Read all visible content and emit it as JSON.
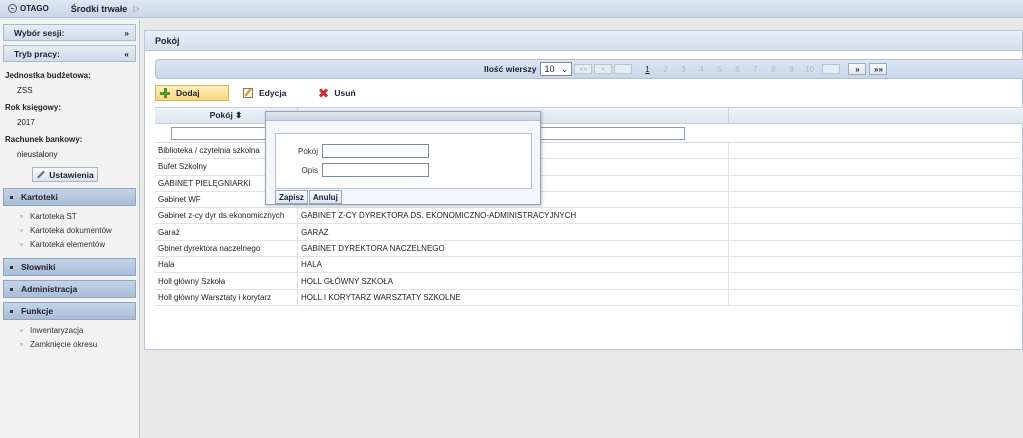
{
  "topbar": {
    "logo": "OTAGO",
    "crumb": "Środki trwałe",
    "arrow": "▷"
  },
  "sidebar": {
    "session_header": {
      "label": "Wybór sesji:",
      "icon": "»"
    },
    "mode_header": {
      "label": "Tryb pracy:",
      "icon": "«"
    },
    "info": [
      {
        "label": "Jednostka budżetowa:",
        "value": "ZSS"
      },
      {
        "label": "Rok księgowy:",
        "value": "2017"
      },
      {
        "label": "Rachunek bankowy:",
        "value": "nieustalony"
      }
    ],
    "settings_button": "Ustawienia",
    "sections": [
      {
        "title": "Kartoteki",
        "items": [
          "Kartoteka ST",
          "Kartoteka dokumentów",
          "Kartoteka elementów"
        ]
      },
      {
        "title": "Słowniki",
        "items": []
      },
      {
        "title": "Administracja",
        "items": []
      },
      {
        "title": "Funkcje",
        "items": [
          "Inwentaryzacja",
          "Zamknięcie okresu"
        ]
      }
    ]
  },
  "panel": {
    "title": "Pokój"
  },
  "pager": {
    "rows_label": "Ilość wierszy",
    "rows_value": "10",
    "first": "««",
    "prev": "«",
    "pages": [
      "1",
      "2",
      "3",
      "4",
      "5",
      "6",
      "7",
      "8",
      "9",
      "10"
    ],
    "current_page": "1",
    "next": "»",
    "last": "»»"
  },
  "toolbar": {
    "add": "Dodaj",
    "edit": "Edycja",
    "delete": "Usuń"
  },
  "grid": {
    "columns": [
      "Pokój ⬍",
      "",
      ""
    ],
    "rows": [
      {
        "room": "Biblioteka / czytelnia szkolna",
        "desc": ""
      },
      {
        "room": "Bufet Szkolny",
        "desc": ""
      },
      {
        "room": "GABINET PIELĘGNIARKI",
        "desc": ""
      },
      {
        "room": "Gabinet WF",
        "desc": ""
      },
      {
        "room": "Gabinet z-cy dyr ds.ekonomicznych",
        "desc": "GABINET Z-CY DYREKTORA DS. EKONOMICZNO-ADMINISTRACYJNYCH"
      },
      {
        "room": "Garaż",
        "desc": "GARAŻ"
      },
      {
        "room": "Gbinet dyrektora naczelnego",
        "desc": "GABINET DYREKTORA NACZELNEGO"
      },
      {
        "room": "Hala",
        "desc": "HALA"
      },
      {
        "room": "Holl główny Szkoła",
        "desc": "HOLL GŁÓWNY SZKOŁA"
      },
      {
        "room": "Holl główny Warsztaty i korytarz",
        "desc": "HOLL I KORYTARZ WARSZTATY SZKOLNE"
      }
    ]
  },
  "dialog": {
    "room_label": "Pokój",
    "desc_label": "Opis",
    "room_value": "",
    "desc_value": "",
    "save": "Zapisz",
    "cancel": "Anuluj"
  }
}
